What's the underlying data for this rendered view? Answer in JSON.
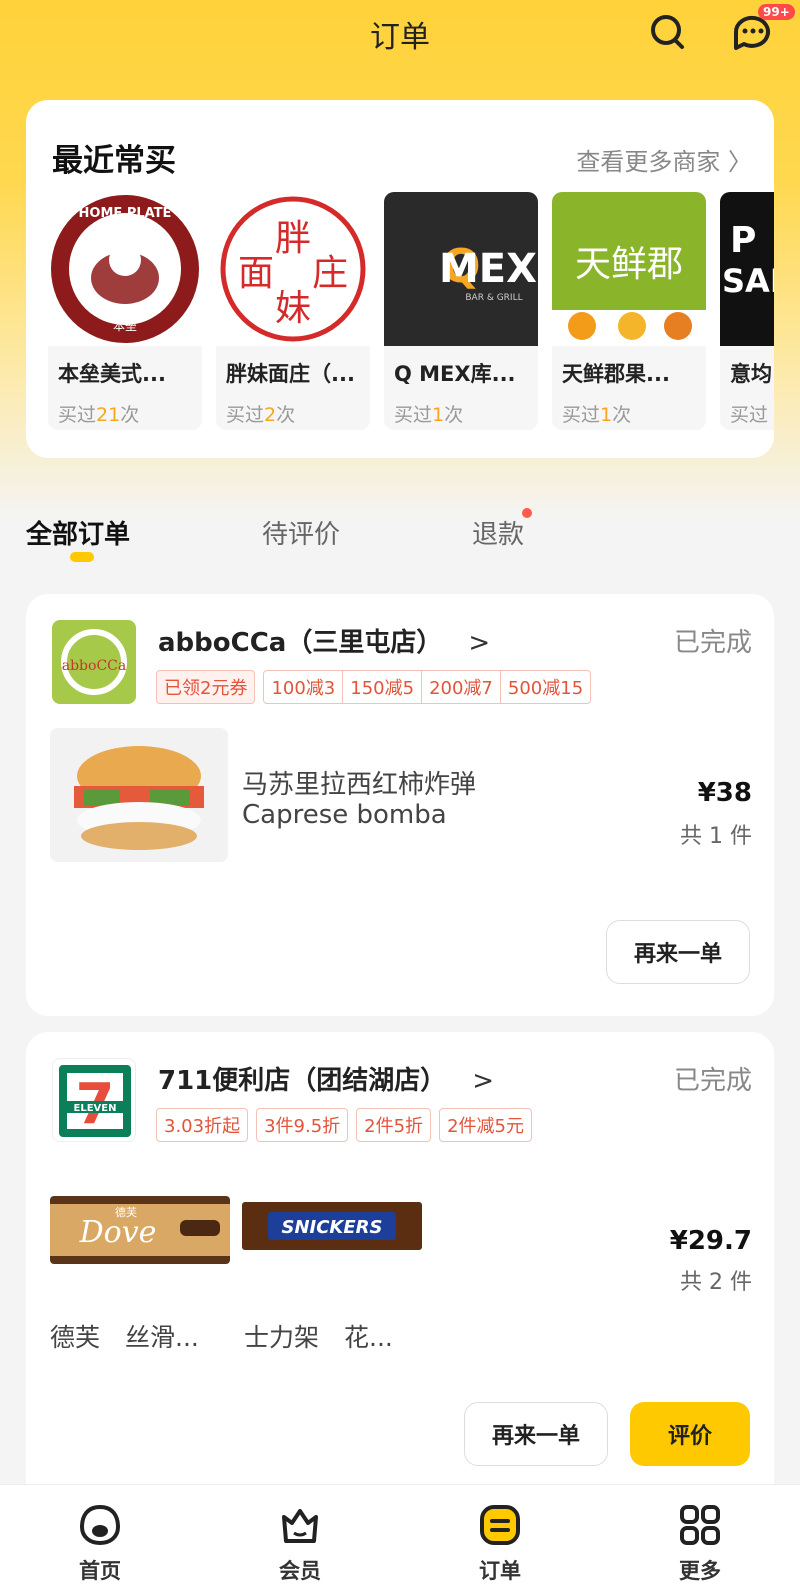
{
  "header": {
    "title": "订单",
    "badge": "99+"
  },
  "recent": {
    "title": "最近常买",
    "more": "查看更多商家 〉",
    "shops": [
      {
        "name": "本垒美式...",
        "prefix": "买过",
        "count": "21",
        "suffix": "次",
        "logo_text": "HOME PLATE",
        "logo_sub": "本垒"
      },
      {
        "name": "胖妹面庄（...",
        "prefix": "买过",
        "count": "2",
        "suffix": "次",
        "logo_text": "胖面庄妹"
      },
      {
        "name": "Q MEX库...",
        "prefix": "买过",
        "count": "1",
        "suffix": "次",
        "logo_text": "QMEX",
        "logo_sub": "BAR & GRILL"
      },
      {
        "name": "天鲜郡果...",
        "prefix": "买过",
        "count": "1",
        "suffix": "次",
        "logo_text": "天鲜郡"
      },
      {
        "name": "意均",
        "prefix": "买过",
        "count": "",
        "suffix": "",
        "logo_text": "P SAL"
      }
    ]
  },
  "tabs": [
    {
      "label": "全部订单"
    },
    {
      "label": "待评价"
    },
    {
      "label": "退款"
    }
  ],
  "orders": [
    {
      "shop": "abboCCa（三里屯店）",
      "status": "已完成",
      "logo_text": "abboCCa",
      "coupon": "已领2元券",
      "promos": [
        "100减3",
        "150减5",
        "200减7",
        "500减15"
      ],
      "item_cn": "马苏里拉西红柿炸弹",
      "item_en": "Caprese bomba",
      "price": "¥38",
      "qty": "共 1 件",
      "buttons": [
        "再来一单"
      ]
    },
    {
      "shop": "711便利店（团结湖店）",
      "status": "已完成",
      "logo_text": "ELEVEN",
      "promos": [
        "3.03折起",
        "3件9.5折",
        "2件5折",
        "2件减5元"
      ],
      "items": [
        {
          "name": "德芙　丝滑...",
          "brand": "Dove",
          "brand_cn": "德芙"
        },
        {
          "name": "士力架　花...",
          "brand": "SNICKERS"
        }
      ],
      "price": "¥29.7",
      "qty": "共 2 件",
      "buttons": [
        "再来一单",
        "评价"
      ]
    }
  ],
  "nav": [
    {
      "label": "首页",
      "icon": "home-icon"
    },
    {
      "label": "会员",
      "icon": "member-icon"
    },
    {
      "label": "订单",
      "icon": "order-icon"
    },
    {
      "label": "更多",
      "icon": "more-grid-icon"
    }
  ],
  "colors": {
    "accent": "#ffc900",
    "promo": "#e2553c",
    "badge": "#ff4a4a"
  }
}
